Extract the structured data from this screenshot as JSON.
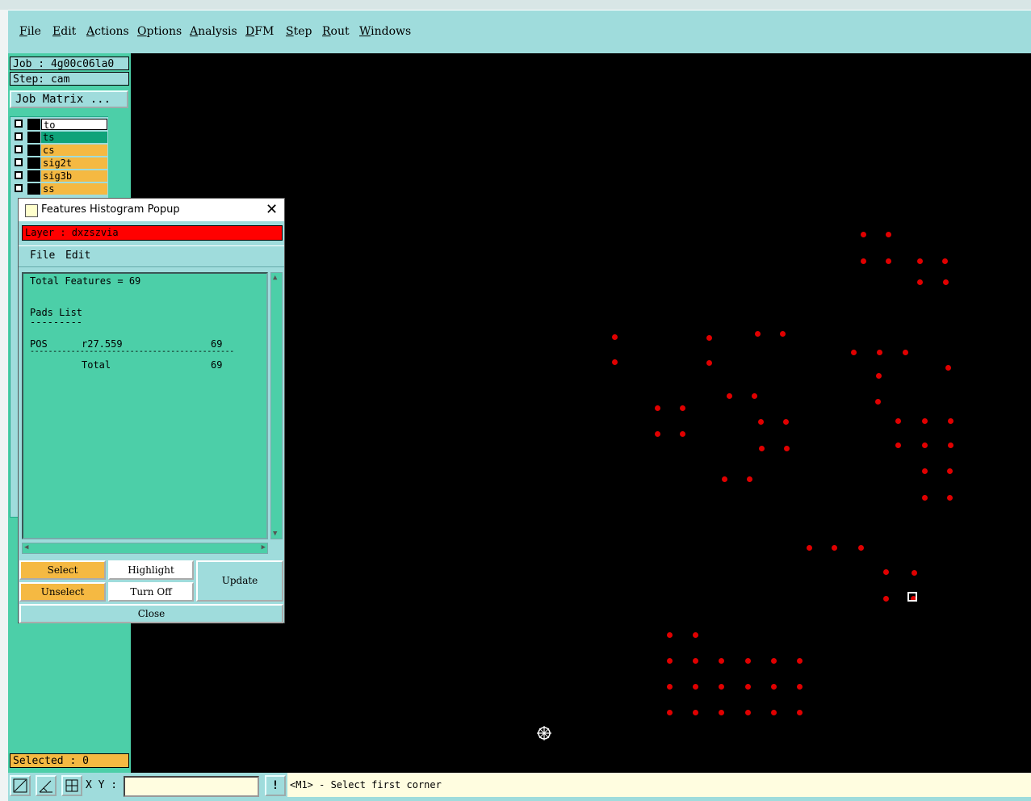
{
  "menubar": {
    "items": [
      "File",
      "Edit",
      "Actions",
      "Options",
      "Analysis",
      "DFM",
      "Step",
      "Rout",
      "Windows"
    ]
  },
  "left_panel": {
    "job": "Job : 4g00c06la0",
    "step": "Step: cam",
    "job_matrix_button": "Job Matrix ...",
    "layers": [
      {
        "name": "to",
        "color": "#ffffff"
      },
      {
        "name": "ts",
        "color": "#0fa37a"
      },
      {
        "name": "cs",
        "color": "#f5b942"
      },
      {
        "name": "sig2t",
        "color": "#f5b942"
      },
      {
        "name": "sig3b",
        "color": "#f5b942"
      },
      {
        "name": "ss",
        "color": "#f5b942"
      }
    ],
    "selected": "Selected : 0"
  },
  "popup": {
    "title": "Features Histogram Popup",
    "layer_label": "Layer :  dxzszvia",
    "menu": [
      "File",
      "Edit"
    ],
    "report": {
      "total_line": "Total Features = 69",
      "section": "Pads List",
      "underline": "---------",
      "row_type": "POS",
      "row_symbol": "r27.559",
      "row_count": "69",
      "divider": "---------------------------------------------",
      "total_label": "Total",
      "total_count": "69"
    },
    "buttons": {
      "select": "Select",
      "unselect": "Unselect",
      "highlight": "Highlight",
      "turn_off": "Turn Off",
      "update": "Update",
      "close": "Close"
    }
  },
  "statusbar": {
    "xy_label": "X Y :",
    "xy_value": "",
    "exclaim": "!",
    "prompt": "<M1> - Select first corner"
  },
  "colors": {
    "panel_teal": "#4ccfa8",
    "light_teal": "#9fdcdc",
    "pad_red": "#e00000",
    "layer_bar_red": "#ff0000",
    "accent_orange": "#f5b942"
  },
  "icons": [
    "close-icon",
    "window-icon",
    "crosshair-cursor-icon",
    "zoom-area-icon",
    "measure-icon",
    "grid-icon"
  ]
}
